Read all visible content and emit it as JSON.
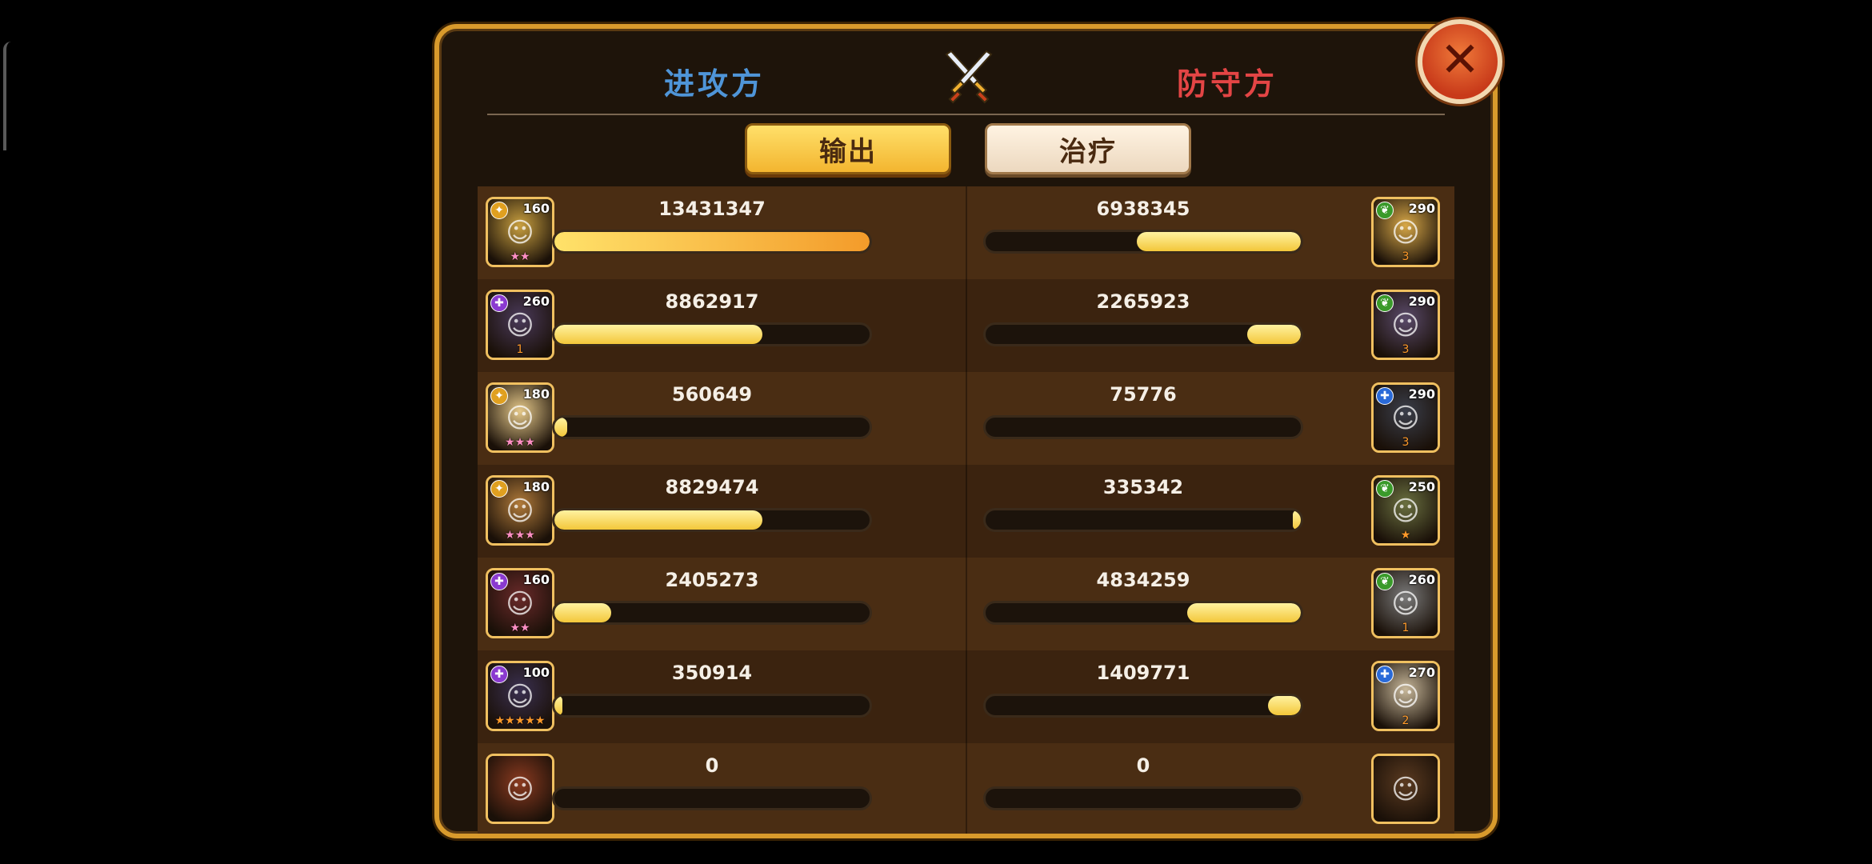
{
  "header": {
    "attacker_title": "进攻方",
    "defender_title": "防守方"
  },
  "tabs": {
    "output_label": "输出",
    "healing_label": "治疗",
    "selected": "output"
  },
  "close_icon": "close-x-icon",
  "rows": [
    {
      "attacker": {
        "value": "13431347",
        "fraction": 1.0,
        "level": "160",
        "element": "light",
        "stars": "★★",
        "star_color": "pink",
        "portrait_color": "#c9a040"
      },
      "defender": {
        "value": "6938345",
        "fraction": 0.52,
        "level": "290",
        "element": "nature",
        "stars": "3",
        "star_color": "orange",
        "portrait_color": "#d8a848"
      }
    },
    {
      "attacker": {
        "value": "8862917",
        "fraction": 0.66,
        "level": "260",
        "element": "dark",
        "stars": "1",
        "star_color": "orange",
        "portrait_color": "#4a3a5a"
      },
      "defender": {
        "value": "2265923",
        "fraction": 0.17,
        "level": "290",
        "element": "nature",
        "stars": "3",
        "star_color": "orange",
        "portrait_color": "#5a4a6a"
      }
    },
    {
      "attacker": {
        "value": "560649",
        "fraction": 0.04,
        "level": "180",
        "element": "light",
        "stars": "★★★",
        "star_color": "pink",
        "portrait_color": "#e6c98a"
      },
      "defender": {
        "value": "75776",
        "fraction": 0.0,
        "level": "290",
        "element": "water",
        "stars": "3",
        "star_color": "orange",
        "portrait_color": "#3a3e4a"
      }
    },
    {
      "attacker": {
        "value": "8829474",
        "fraction": 0.66,
        "level": "180",
        "element": "light",
        "stars": "★★★",
        "star_color": "pink",
        "portrait_color": "#b07a3a"
      },
      "defender": {
        "value": "335342",
        "fraction": 0.025,
        "level": "250",
        "element": "nature",
        "stars": "★",
        "star_color": "orange",
        "portrait_color": "#6a7040"
      }
    },
    {
      "attacker": {
        "value": "2405273",
        "fraction": 0.18,
        "level": "160",
        "element": "dark",
        "stars": "★★",
        "star_color": "pink",
        "portrait_color": "#6a2a2a"
      },
      "defender": {
        "value": "4834259",
        "fraction": 0.36,
        "level": "260",
        "element": "nature",
        "stars": "1",
        "star_color": "orange",
        "portrait_color": "#7a7a7a"
      }
    },
    {
      "attacker": {
        "value": "350914",
        "fraction": 0.026,
        "level": "100",
        "element": "dark",
        "stars": "★★★★★",
        "star_color": "orange",
        "portrait_color": "#3a3050"
      },
      "defender": {
        "value": "1409771",
        "fraction": 0.105,
        "level": "270",
        "element": "water",
        "stars": "2",
        "star_color": "orange",
        "portrait_color": "#c8b89a"
      }
    },
    {
      "attacker": {
        "value": "0",
        "fraction": 0.0,
        "level": "",
        "element": "",
        "stars": "",
        "star_color": "orange",
        "portrait_color": "#8a3a20"
      },
      "defender": {
        "value": "0",
        "fraction": 0.0,
        "level": "",
        "element": "",
        "stars": "",
        "star_color": "orange",
        "portrait_color": "#5a3a20"
      }
    }
  ],
  "colors": {
    "attacker_title": "#4f95d8",
    "defender_title": "#e44545",
    "panel_border": "#d89a2c",
    "bar_fill": "#f3c73a"
  }
}
